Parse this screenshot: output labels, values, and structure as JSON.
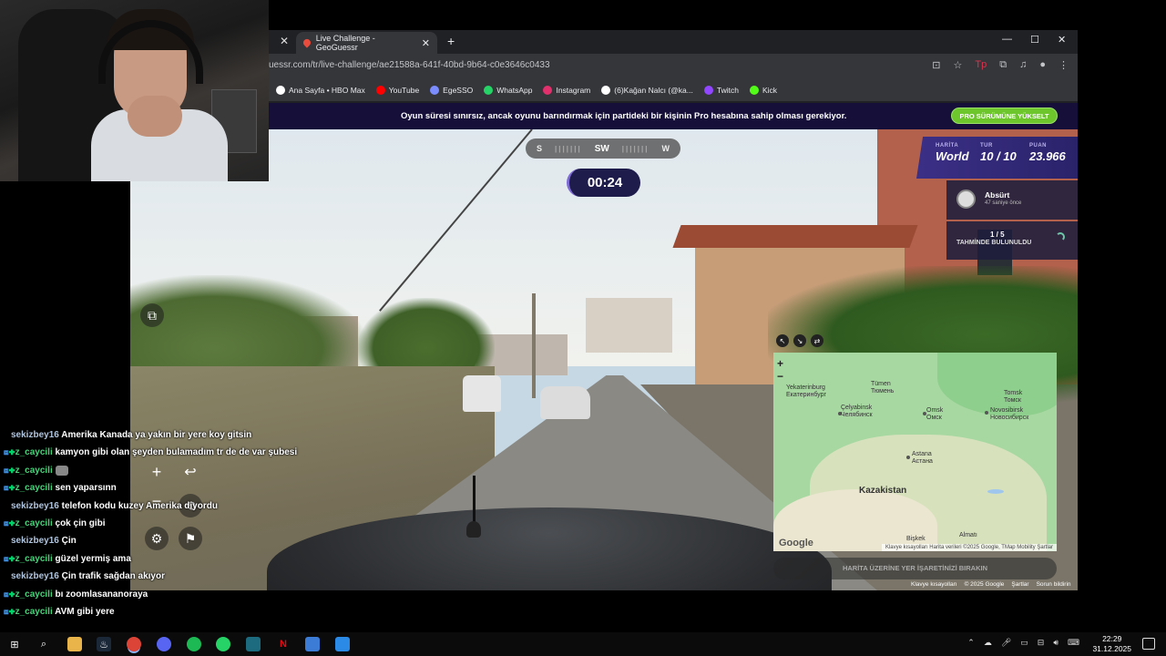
{
  "browser": {
    "tab_title": "Live Challenge - GeoGuessr",
    "url": "uessr.com/tr/live-challenge/ae21588a-641f-40bd-9b64-c0e3646c0433",
    "bookmarks": [
      {
        "label": "Ana Sayfa • HBO Max",
        "color": "#ffffff"
      },
      {
        "label": "YouTube",
        "color": "#ff0000"
      },
      {
        "label": "EgeSSO",
        "color": "#7b8cff"
      },
      {
        "label": "WhatsApp",
        "color": "#25d366"
      },
      {
        "label": "Instagram",
        "color": "#e1306c"
      },
      {
        "label": "(6)Kağan Nalcı (@ka...",
        "color": "#ffffff"
      },
      {
        "label": "Twitch",
        "color": "#9146ff"
      },
      {
        "label": "Kick",
        "color": "#53fc18"
      }
    ]
  },
  "promo": {
    "text": "Oyun süresi sınırsız, ancak oyunu barındırmak için partideki bir kişinin Pro hesabına sahip olması gerekiyor.",
    "button": "PRO SÜRÜMÜNE YÜKSELT"
  },
  "game": {
    "compass": {
      "left": "S",
      "center": "SW",
      "right": "W"
    },
    "timer": "00:24",
    "stats": {
      "map_label": "HARİTA",
      "map_value": "World",
      "round_label": "TUR",
      "round_value": "10 / 10",
      "score_label": "PUAN",
      "score_value": "23.966"
    },
    "player": {
      "name": "Absürt",
      "time": "47 saniye önce"
    },
    "found": {
      "count": "1 / 5",
      "text": "TAHMİNDE BULUNULDU"
    },
    "guess_button": "HARİTA ÜZERİNE YER İŞARETİNİZİ BIRAKIN",
    "footer": [
      "Klavye kısayolları",
      "© 2025 Google",
      "Şartlar",
      "Sorun bildirin"
    ]
  },
  "map": {
    "labels": {
      "yekaterinburg": "Yekaterinburg\nЕкатеринбург",
      "tumen": "Tümen\nТюмень",
      "tomsk": "Tomsk\nТомск",
      "celyabinsk": "Çelyabinsk\nЧелябинск",
      "omsk": "Omsk\nОмск",
      "novosibirsk": "Novosibirsk\nНовосибирск",
      "astana": "Astana\nАстана",
      "kazakistan": "Kazakistan",
      "biskek": "Bişkek",
      "almati": "Almatı"
    },
    "google": "Google",
    "attribution": "Klavye kısayolları    Harita verileri ©2025 Google, TMap Mobility    Şartlar"
  },
  "chat": [
    {
      "user": "sekizbey16",
      "style": "b",
      "badges": false,
      "msg": "Amerika Kanada ya yakın bir yere koy gitsin"
    },
    {
      "user": "z_caycili",
      "style": "a",
      "badges": true,
      "msg": "kamyon gibi olan şeyden bulamadım tr de de var şubesi"
    },
    {
      "user": "z_caycili",
      "style": "a",
      "badges": true,
      "msg": "",
      "emote": true
    },
    {
      "user": "z_caycili",
      "style": "a",
      "badges": true,
      "msg": "sen yaparsınn"
    },
    {
      "user": "sekizbey16",
      "style": "b",
      "badges": false,
      "msg": "telefon kodu kuzey Amerika diyordu"
    },
    {
      "user": "z_caycili",
      "style": "a",
      "badges": true,
      "msg": "çok çin gibi"
    },
    {
      "user": "sekizbey16",
      "style": "b",
      "badges": false,
      "msg": "Çin"
    },
    {
      "user": "z_caycili",
      "style": "a",
      "badges": true,
      "msg": "güzel yermiş ama"
    },
    {
      "user": "sekizbey16",
      "style": "b",
      "badges": false,
      "msg": "Çin trafik sağdan akıyor"
    },
    {
      "user": "z_caycili",
      "style": "a",
      "badges": true,
      "msg": "bı zoomlasananoraya"
    },
    {
      "user": "z_caycili",
      "style": "a",
      "badges": true,
      "msg": "AVM gibi yere"
    }
  ],
  "taskbar": {
    "time": "22:29",
    "date": "31.12.2025"
  }
}
